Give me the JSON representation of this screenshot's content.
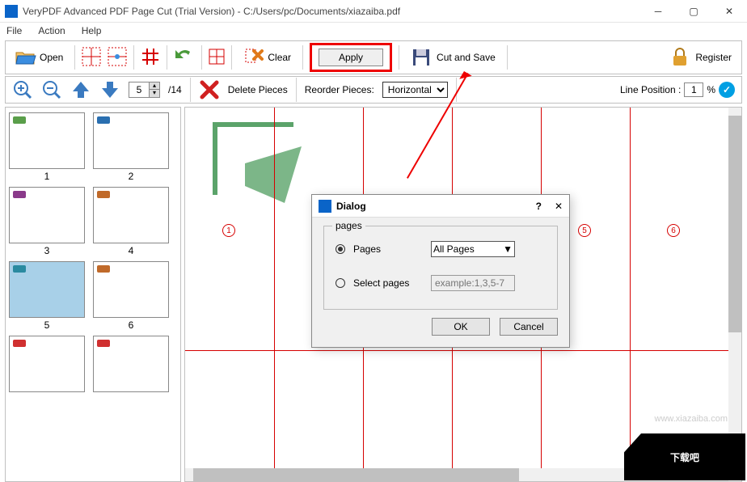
{
  "window": {
    "title": "VeryPDF Advanced PDF Page Cut (Trial Version) - C:/Users/pc/Documents/xiazaiba.pdf"
  },
  "menu": {
    "file": "File",
    "action": "Action",
    "help": "Help"
  },
  "toolbar": {
    "open": "Open",
    "clear": "Clear",
    "apply": "Apply",
    "cut_and_save": "Cut and Save",
    "register": "Register"
  },
  "toolbar2": {
    "page_current": "5",
    "page_total": "/14",
    "delete_pieces": "Delete Pieces",
    "reorder_label": "Reorder Pieces:",
    "reorder_value": "Horizontal",
    "line_pos_label": "Line Position :",
    "line_pos_value": "1",
    "line_pos_unit": "%"
  },
  "thumbs": [
    {
      "n": "1",
      "color": "#5a9e4a"
    },
    {
      "n": "2",
      "color": "#2a6fb0"
    },
    {
      "n": "3",
      "color": "#8a3a8a"
    },
    {
      "n": "4",
      "color": "#c06a2a"
    },
    {
      "n": "5",
      "color": "#2a8aa0",
      "selected": true
    },
    {
      "n": "6",
      "color": "#c06a2a"
    },
    {
      "n": "",
      "color": "#d03030"
    },
    {
      "n": "",
      "color": "#d03030"
    }
  ],
  "cells": [
    "1",
    "5",
    "6"
  ],
  "dialog": {
    "title": "Dialog",
    "group": "pages",
    "opt_pages": "Pages",
    "opt_select": "Select pages",
    "all_pages": "All Pages",
    "placeholder": "example:1,3,5-7",
    "ok": "OK",
    "cancel": "Cancel"
  },
  "watermark": "www.xiazaiba.com",
  "bottom_logo": "下载吧"
}
